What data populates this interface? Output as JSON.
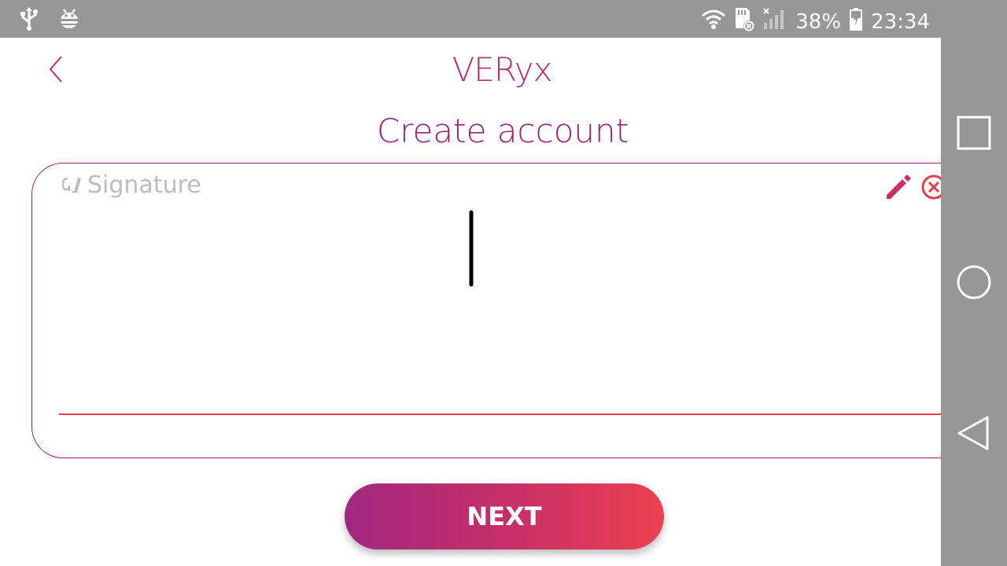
{
  "status_bar": {
    "battery_percent": "38%",
    "time": "23:34",
    "icons": [
      "usb-icon",
      "android-debug-icon",
      "wifi-icon",
      "sd-card-error-icon",
      "signal-off-icon",
      "battery-charging-icon"
    ]
  },
  "header": {
    "app_title": "VERyx",
    "page_title": "Create account"
  },
  "signature": {
    "label": "Signature"
  },
  "actions": {
    "next_label": "NEXT"
  },
  "navigation": {
    "buttons": [
      "recent-apps",
      "home",
      "back"
    ]
  },
  "colors": {
    "status_bar": "#979797",
    "brand_primary": "#b73073",
    "brand_dark": "#9c2077",
    "accent_red": "#e43d4b",
    "placeholder_gray": "#bdbdbd"
  }
}
